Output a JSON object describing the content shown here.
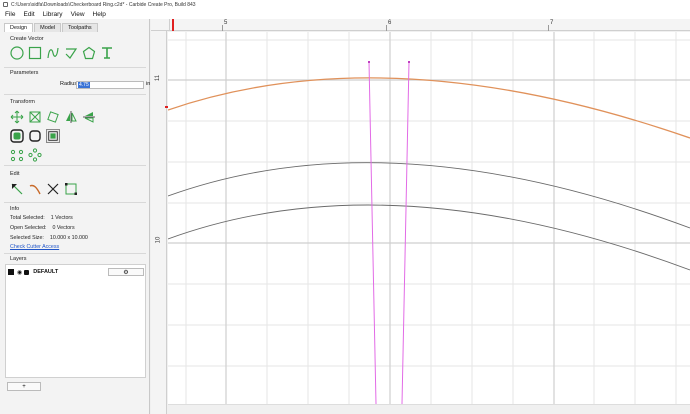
{
  "window": {
    "title": "C:\\Users\\sidfa\\Downloads\\Checkerboard Ring.c2d* - Carbide Create Pro, Build 843"
  },
  "menu": {
    "items": [
      "File",
      "Edit",
      "Library",
      "View",
      "Help"
    ]
  },
  "tabs": [
    "Design",
    "Model",
    "Toolpaths"
  ],
  "sections": {
    "create_vector": "Create Vector",
    "parameters": "Parameters",
    "transform": "Transform",
    "edit": "Edit",
    "info": "Info",
    "layers": "Layers"
  },
  "parameters": {
    "radius_label": "Radius",
    "radius_value": "4.75",
    "radius_unit": "in"
  },
  "info": {
    "total_selected_label": "Total Selected:",
    "total_selected_value": "1 Vectors",
    "open_selected_label": "Open Selected:",
    "open_selected_value": "0 Vectors",
    "selected_size_label": "Selected Size:",
    "selected_size_value": "10.000 x 10.000",
    "check_cutter_link": "Check Cutter Access"
  },
  "layers": {
    "items": [
      {
        "name": "DEFAULT",
        "color": "#111111"
      }
    ],
    "add_label": "+",
    "gear_icon": "gear-icon"
  },
  "ruler": {
    "top_labels": [
      "5",
      "6",
      "7"
    ],
    "left_labels": [
      "11",
      "10"
    ]
  },
  "colors": {
    "selected_arc": "#e0915a",
    "arcs": "#6a6a6a",
    "toolpath_lines": "#e26be6",
    "accent": "#3a73d6",
    "icon_green": "#3aa34a",
    "ruler_marker": "#e02020"
  },
  "icons": [
    "circle-icon",
    "rectangle-icon",
    "curve-icon",
    "polyline-icon",
    "polygon-icon",
    "text-icon"
  ]
}
